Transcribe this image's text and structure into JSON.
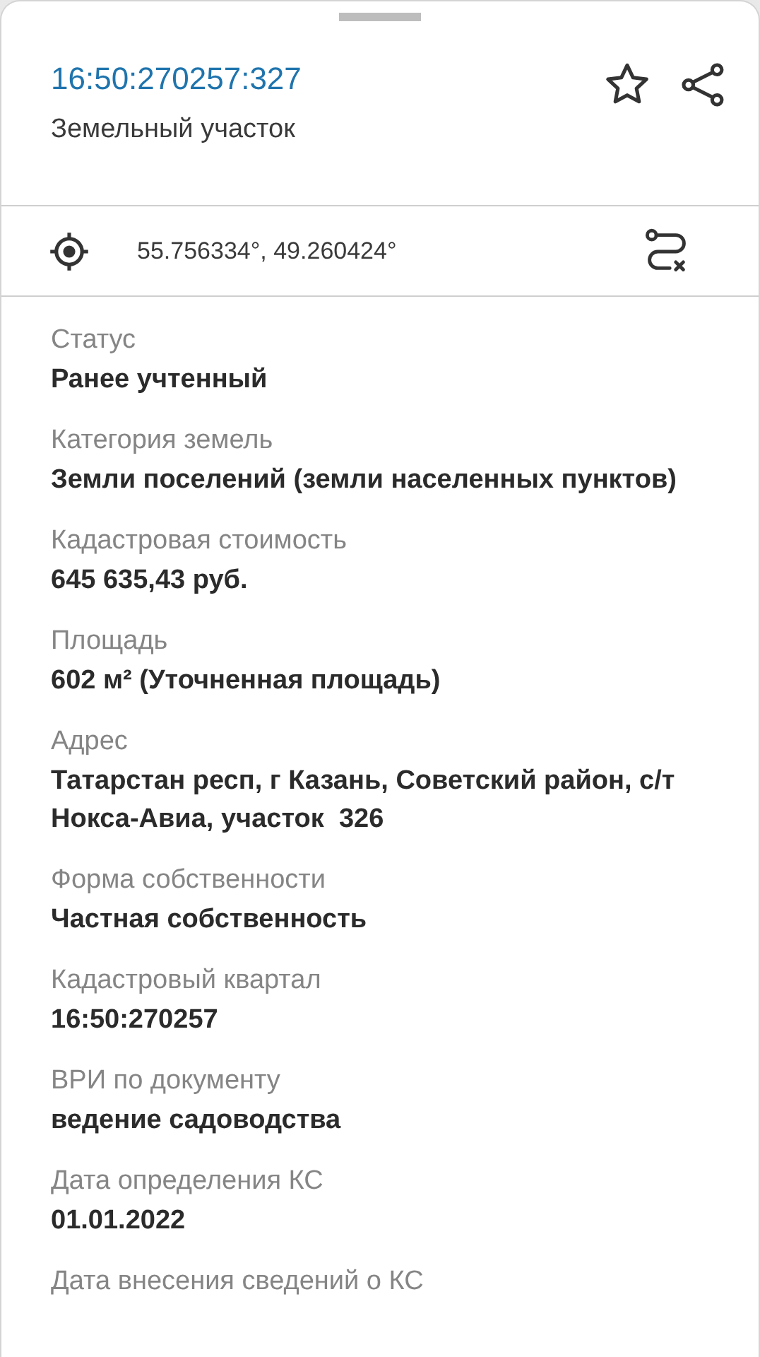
{
  "header": {
    "title": "16:50:270257:327",
    "subtitle": "Земельный участок"
  },
  "coordinates": {
    "text": "55.756334°, 49.260424°"
  },
  "fields": [
    {
      "label": "Статус",
      "value": "Ранее учтенный"
    },
    {
      "label": "Категория земель",
      "value": "Земли поселений (земли населенных пунктов)"
    },
    {
      "label": "Кадастровая стоимость",
      "value": "645 635,43 руб."
    },
    {
      "label": "Площадь",
      "value": "602 м² (Уточненная площадь)"
    },
    {
      "label": "Адрес",
      "value": "Татарстан респ, г Казань, Советский район, с/т Нокса-Авиа, участок  326"
    },
    {
      "label": "Форма собственности",
      "value": "Частная собственность"
    },
    {
      "label": "Кадастровый квартал",
      "value": "16:50:270257"
    },
    {
      "label": "ВРИ по документу",
      "value": "ведение садоводства"
    },
    {
      "label": "Дата определения КС",
      "value": "01.01.2022"
    },
    {
      "label": "Дата внесения сведений о КС"
    }
  ]
}
